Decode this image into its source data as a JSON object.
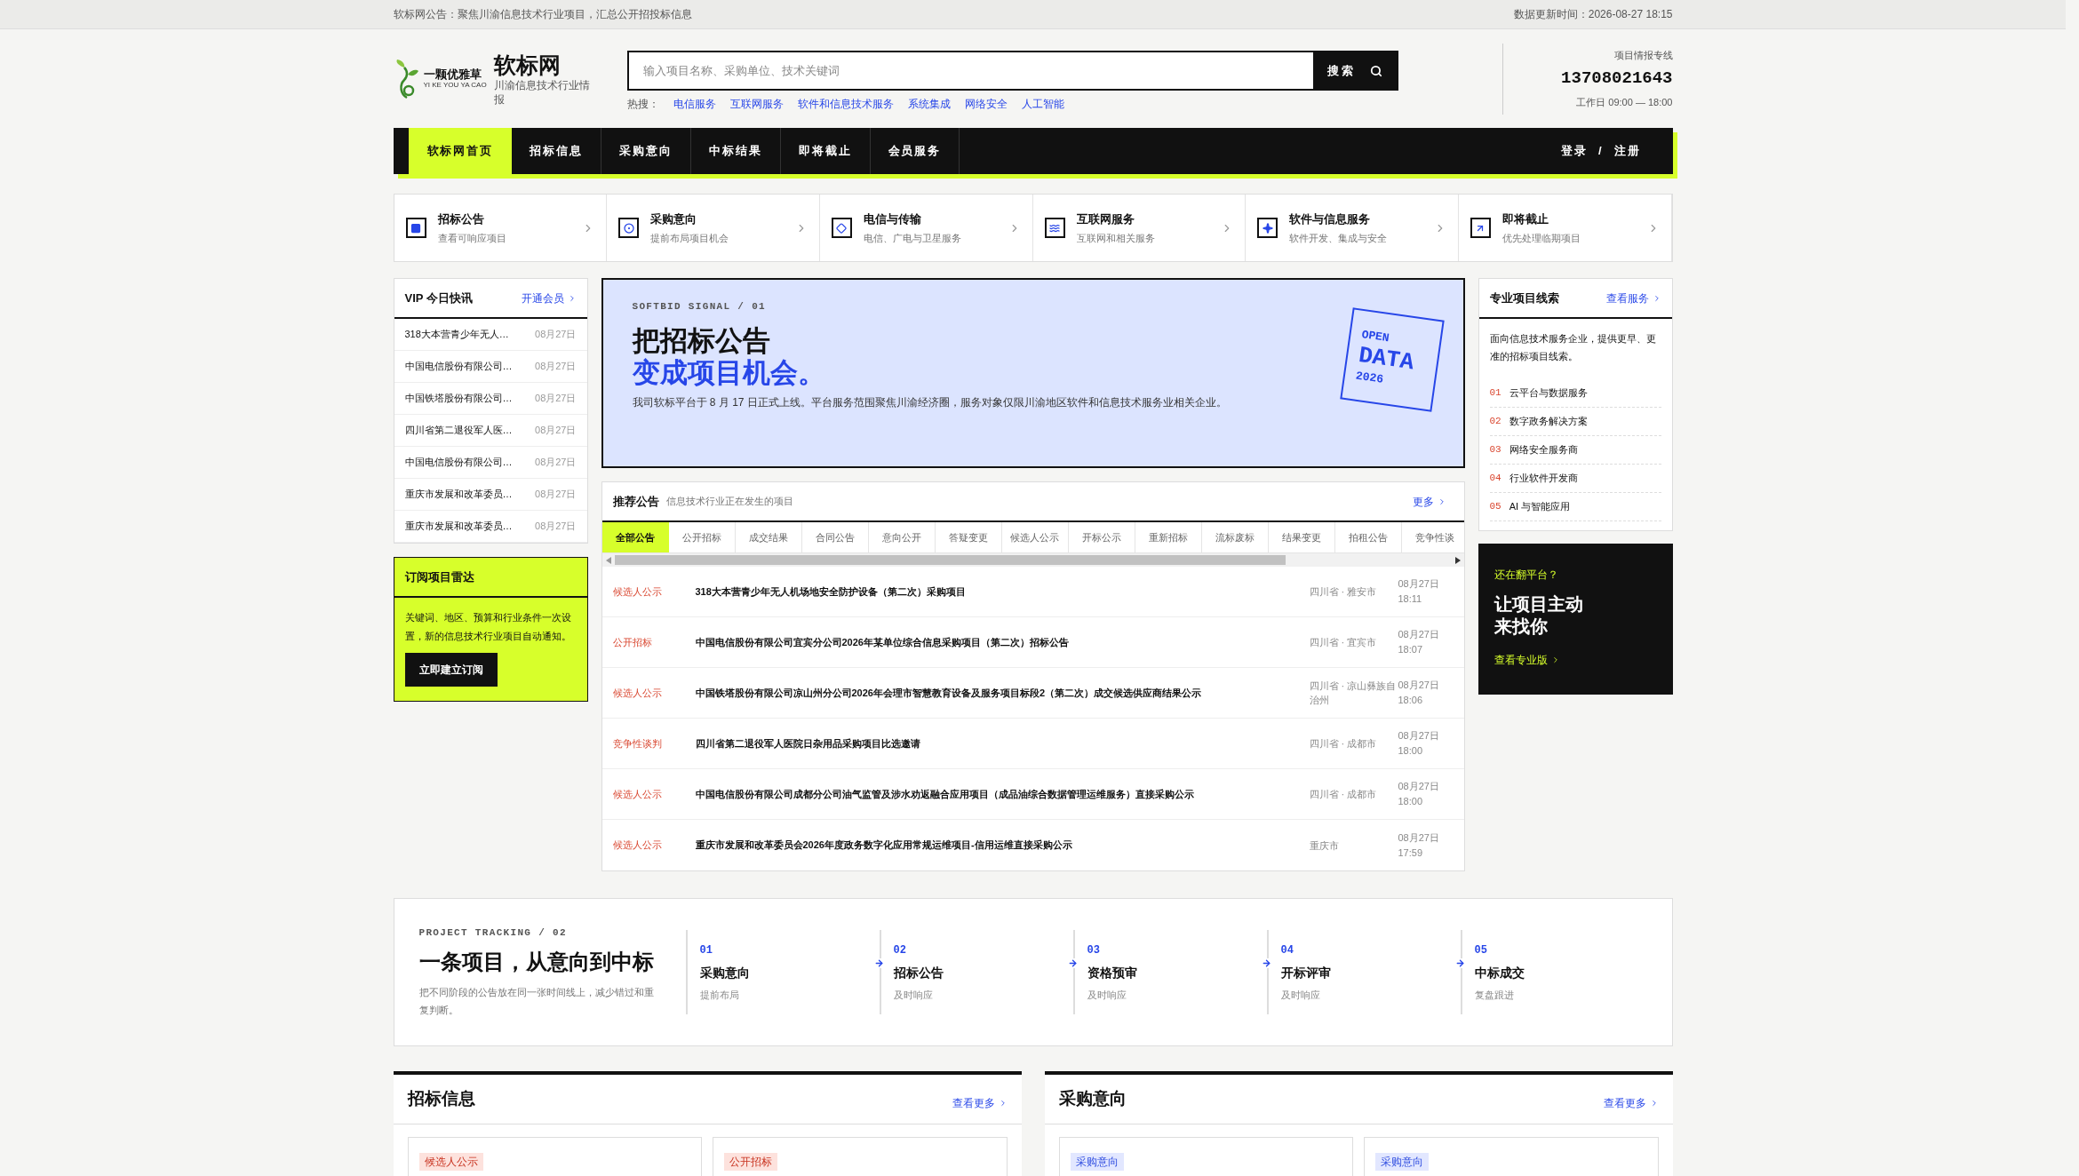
{
  "top_bar": {
    "notice": "软标网公告：聚焦川渝信息技术行业项目，汇总公开招投标信息",
    "updated": "数据更新时间：2026-08-27 18:15"
  },
  "header": {
    "logo_text": "一颗优雅草",
    "logo_subtext": "YI KE YOU YA CAO",
    "site_name": "软标网",
    "tagline": "川渝信息技术行业情报",
    "search": {
      "placeholder": "输入项目名称、采购单位、技术关键词",
      "button": "搜索"
    },
    "hot_label": "热搜：",
    "hot_links": [
      "电信服务",
      "互联网服务",
      "软件和信息技术服务",
      "系统集成",
      "网络安全",
      "人工智能"
    ],
    "hotline_label": "项目情报专线",
    "phone": "13708021643",
    "hours": "工作日 09:00 — 18:00"
  },
  "nav": {
    "items": [
      {
        "label": "软标网首页",
        "selected": true
      },
      {
        "label": "招标信息",
        "selected": false
      },
      {
        "label": "采购意向",
        "selected": false
      },
      {
        "label": "中标结果",
        "selected": false
      },
      {
        "label": "即将截止",
        "selected": false
      },
      {
        "label": "会员服务",
        "selected": false
      }
    ],
    "login": "登录",
    "separator": "/",
    "register": "注册"
  },
  "categories": [
    {
      "title": "招标公告",
      "subtitle": "查看可响应项目"
    },
    {
      "title": "采购意向",
      "subtitle": "提前布局项目机会"
    },
    {
      "title": "电信与传输",
      "subtitle": "电信、广电与卫星服务"
    },
    {
      "title": "互联网服务",
      "subtitle": "互联网和相关服务"
    },
    {
      "title": "软件与信息服务",
      "subtitle": "软件开发、集成与安全"
    },
    {
      "title": "即将截止",
      "subtitle": "优先处理临期项目"
    }
  ],
  "vip": {
    "title": "VIP 今日快讯",
    "link": "开通会员",
    "items": [
      {
        "title": "318大本营青少年无人…",
        "date": "08月27日"
      },
      {
        "title": "中国电信股份有限公司…",
        "date": "08月27日"
      },
      {
        "title": "中国铁塔股份有限公司…",
        "date": "08月27日"
      },
      {
        "title": "四川省第二退役军人医…",
        "date": "08月27日"
      },
      {
        "title": "中国电信股份有限公司…",
        "date": "08月27日"
      },
      {
        "title": "重庆市发展和改革委员…",
        "date": "08月27日"
      },
      {
        "title": "重庆市发展和改革委员…",
        "date": "08月27日"
      }
    ]
  },
  "subscribe": {
    "title": "订阅项目雷达",
    "text": "关键词、地区、预算和行业条件一次设置，新的信息技术行业项目自动通知。",
    "button": "立即建立订阅"
  },
  "banner": {
    "eyebrow": "SOFTBID SIGNAL / 01",
    "headline": "把招标公告",
    "headline_accent": "变成项目机会。",
    "text": "我司软标平台于 8 月 17 日正式上线。平台服务范围聚焦川渝经济圈，服务对象仅限川渝地区软件和信息技术服务业相关企业。",
    "stamp": [
      "OPEN",
      "DATA",
      "2026"
    ]
  },
  "recommended": {
    "title": "推荐公告",
    "subtitle": "信息技术行业正在发生的项目",
    "more": "更多",
    "tabs": [
      {
        "label": "全部公告",
        "selected": true
      },
      {
        "label": "公开招标",
        "selected": false
      },
      {
        "label": "成交结果",
        "selected": false
      },
      {
        "label": "合同公告",
        "selected": false
      },
      {
        "label": "意向公开",
        "selected": false
      },
      {
        "label": "答疑变更",
        "selected": false
      },
      {
        "label": "候选人公示",
        "selected": false
      },
      {
        "label": "开标公示",
        "selected": false
      },
      {
        "label": "重新招标",
        "selected": false
      },
      {
        "label": "流标废标",
        "selected": false
      },
      {
        "label": "结果变更",
        "selected": false
      },
      {
        "label": "拍租公告",
        "selected": false
      },
      {
        "label": "竞争性谈",
        "selected": false
      }
    ],
    "rows": [
      {
        "tag": "候选人公示",
        "title": "318大本营青少年无人机场地安全防护设备（第二次）采购项目",
        "region": "四川省 · 雅安市",
        "date": "08月27日",
        "time": "18:11"
      },
      {
        "tag": "公开招标",
        "title": "中国电信股份有限公司宜宾分公司2026年某单位综合信息采购项目（第二次）招标公告",
        "region": "四川省 · 宜宾市",
        "date": "08月27日",
        "time": "18:07"
      },
      {
        "tag": "候选人公示",
        "title": "中国铁塔股份有限公司凉山州分公司2026年会理市智慧教育设备及服务项目标段2（第二次）成交候选供应商结果公示",
        "region": "四川省 · 凉山彝族自治州",
        "date": "08月27日",
        "time": "18:06"
      },
      {
        "tag": "竞争性谈判",
        "title": "四川省第二退役军人医院日杂用品采购项目比选邀请",
        "region": "四川省 · 成都市",
        "date": "08月27日",
        "time": "18:00"
      },
      {
        "tag": "候选人公示",
        "title": "中国电信股份有限公司成都分公司油气监管及涉水劝返融合应用项目（成品油综合数据管理运维服务）直接采购公示",
        "region": "四川省 · 成都市",
        "date": "08月27日",
        "time": "18:00"
      },
      {
        "tag": "候选人公示",
        "title": "重庆市发展和改革委员会2026年度政务数字化应用常规运维项目-信用运维直接采购公示",
        "region": "重庆市",
        "date": "08月27日",
        "time": "17:59"
      }
    ]
  },
  "leads": {
    "title": "专业项目线索",
    "link": "查看服务",
    "intro": "面向信息技术服务企业，提供更早、更准的招标项目线索。",
    "items": [
      {
        "num": "01",
        "label": "云平台与数据服务"
      },
      {
        "num": "02",
        "label": "数字政务解决方案"
      },
      {
        "num": "03",
        "label": "网络安全服务商"
      },
      {
        "num": "04",
        "label": "行业软件开发商"
      },
      {
        "num": "05",
        "label": "AI 与智能应用"
      }
    ]
  },
  "promo": {
    "eyebrow": "还在翻平台？",
    "headline": [
      "让项目主动",
      "来找你"
    ],
    "link": "查看专业版"
  },
  "tracking": {
    "eyebrow": "PROJECT TRACKING / 02",
    "title": "一条项目，从意向到中标",
    "text": "把不同阶段的公告放在同一张时间线上，减少错过和重复判断。",
    "steps": [
      {
        "num": "01",
        "title": "采购意向",
        "note": "提前布局"
      },
      {
        "num": "02",
        "title": "招标公告",
        "note": "及时响应"
      },
      {
        "num": "03",
        "title": "资格预审",
        "note": "及时响应"
      },
      {
        "num": "04",
        "title": "开标评审",
        "note": "及时响应"
      },
      {
        "num": "05",
        "title": "中标成交",
        "note": "复盘跟进"
      }
    ]
  },
  "sections": [
    {
      "title": "招标信息",
      "more": "查看更多",
      "cards": [
        {
          "tag": "候选人公示",
          "kind": "bidding"
        },
        {
          "tag": "公开招标",
          "kind": "bidding"
        }
      ]
    },
    {
      "title": "采购意向",
      "more": "查看更多",
      "cards": [
        {
          "tag": "采购意向",
          "kind": "intention"
        },
        {
          "tag": "采购意向",
          "kind": "intention"
        }
      ]
    }
  ]
}
